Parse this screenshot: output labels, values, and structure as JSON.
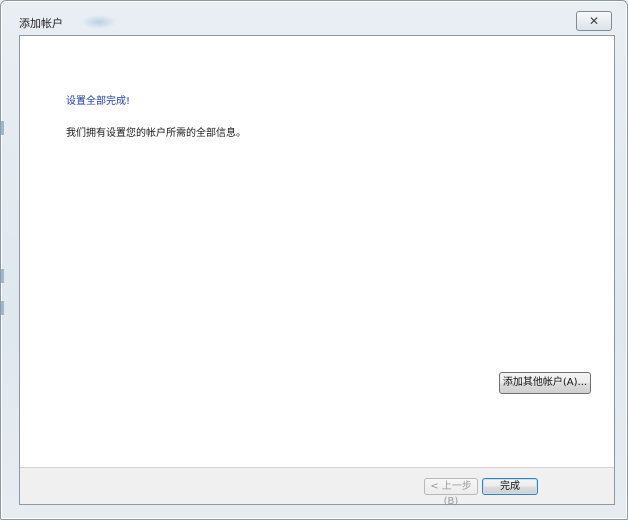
{
  "window": {
    "title": "添加帐户",
    "close_symbol": "✕"
  },
  "main": {
    "heading": "设置全部完成!",
    "info": "我们拥有设置您的帐户所需的全部信息。",
    "add_other_button": "添加其他帐户(A)..."
  },
  "footer": {
    "back_button": "< 上一步(B)",
    "finish_button": "完成"
  },
  "colors": {
    "heading": "#1f3fa8",
    "finish_border": "#3c7fb1"
  }
}
